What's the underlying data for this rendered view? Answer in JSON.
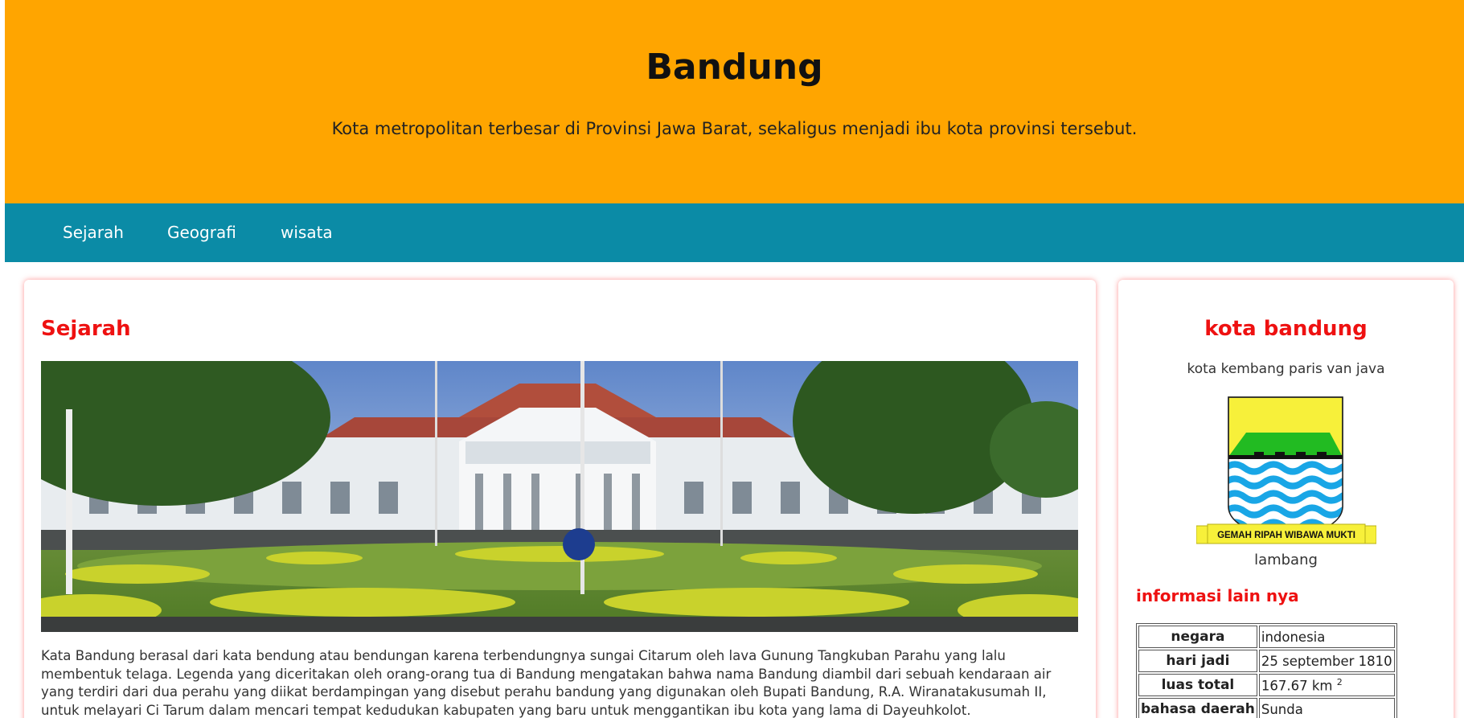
{
  "header": {
    "title": "Bandung",
    "subtitle": "Kota metropolitan terbesar di Provinsi Jawa Barat, sekaligus menjadi ibu kota provinsi tersebut."
  },
  "nav": {
    "items": [
      {
        "label": "Sejarah"
      },
      {
        "label": "Geografi"
      },
      {
        "label": "wisata"
      }
    ]
  },
  "main": {
    "title": "Sejarah",
    "paragraph": "Kata Bandung berasal dari kata bendung atau bendungan karena terbendungnya sungai Citarum oleh lava Gunung Tangkuban Parahu yang lalu membentuk telaga. Legenda yang diceritakan oleh orang-orang tua di Bandung mengatakan bahwa nama Bandung diambil dari sebuah kendaraan air yang terdiri dari dua perahu yang diikat berdampingan yang disebut perahu bandung yang digunakan oleh Bupati Bandung, R.A. Wiranatakusumah II, untuk melayari Ci Tarum dalam mencari tempat kedudukan kabupaten yang baru untuk menggantikan ibu kota yang lama di Dayeuhkolot."
  },
  "sidebar": {
    "title": "kota bandung",
    "tagline": "kota kembang paris van java",
    "emblem_caption": "lambang",
    "emblem_motto": "GEMAH RIPAH WIBAWA MUKTI",
    "info_title": "informasi lain nya",
    "info": [
      {
        "key": "negara",
        "value": "indonesia"
      },
      {
        "key": "hari jadi",
        "value": "25 september 1810"
      },
      {
        "key": "luas total",
        "value": "167.67 km",
        "sup": "2"
      },
      {
        "key": "bahasa daerah",
        "value": "Sunda"
      }
    ]
  },
  "colors": {
    "header_bg": "#ffa500",
    "nav_bg": "#0b8ba6",
    "accent_red": "#ee1111"
  }
}
